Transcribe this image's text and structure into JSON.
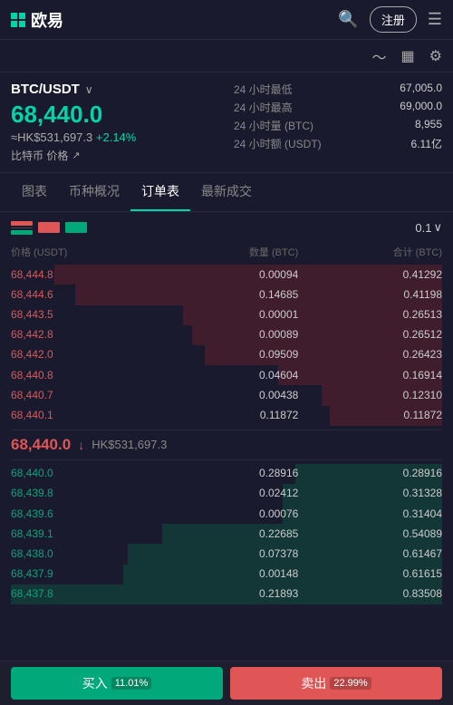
{
  "header": {
    "logo_text": "欧易",
    "register_label": "注册",
    "tab_icon": "≡"
  },
  "pair": {
    "name": "BTC/USDT",
    "main_price": "68,440.0",
    "hk_price": "≈HK$531,697.3",
    "change": "+2.14%",
    "sub_label": "比特币 价格",
    "stats": [
      {
        "label": "24 小时最低",
        "value": "67,005.0"
      },
      {
        "label": "24 小时最高",
        "value": "69,000.0"
      },
      {
        "label": "24 小时量 (BTC)",
        "value": "8,955"
      },
      {
        "label": "24 小时额 (USDT)",
        "value": "6.11亿"
      }
    ]
  },
  "tabs": [
    {
      "label": "图表",
      "active": false
    },
    {
      "label": "币种概况",
      "active": false
    },
    {
      "label": "订单表",
      "active": true
    },
    {
      "label": "最新成交",
      "active": false
    }
  ],
  "orderbook": {
    "precision": "0.1",
    "col_headers": [
      "价格 (USDT)",
      "数量 (BTC)",
      "合计 (BTC)"
    ],
    "asks": [
      {
        "price": "68,444.8",
        "qty": "0.00094",
        "total": "0.41292",
        "bar": 90
      },
      {
        "price": "68,444.6",
        "qty": "0.14685",
        "total": "0.41198",
        "bar": 85
      },
      {
        "price": "68,443.5",
        "qty": "0.00001",
        "total": "0.26513",
        "bar": 60
      },
      {
        "price": "68,442.8",
        "qty": "0.00089",
        "total": "0.26512",
        "bar": 58
      },
      {
        "price": "68,442.0",
        "qty": "0.09509",
        "total": "0.26423",
        "bar": 55
      },
      {
        "price": "68,440.8",
        "qty": "0.04604",
        "total": "0.16914",
        "bar": 38
      },
      {
        "price": "68,440.7",
        "qty": "0.00438",
        "total": "0.12310",
        "bar": 28
      },
      {
        "price": "68,440.1",
        "qty": "0.11872",
        "total": "0.11872",
        "bar": 26
      }
    ],
    "current_price": "68,440.0",
    "current_hk": "HK$531,697.3",
    "bids": [
      {
        "price": "68,440.0",
        "qty": "0.28916",
        "total": "0.28916",
        "bar": 34
      },
      {
        "price": "68,439.8",
        "qty": "0.02412",
        "total": "0.31328",
        "bar": 37
      },
      {
        "price": "68,439.6",
        "qty": "0.00076",
        "total": "0.31404",
        "bar": 37
      },
      {
        "price": "68,439.1",
        "qty": "0.22685",
        "total": "0.54089",
        "bar": 65
      },
      {
        "price": "68,438.0",
        "qty": "0.07378",
        "total": "0.61467",
        "bar": 73
      },
      {
        "price": "68,437.9",
        "qty": "0.00148",
        "total": "0.61615",
        "bar": 74
      },
      {
        "price": "68,437.8",
        "qty": "0.21893",
        "total": "0.83508",
        "bar": 100
      }
    ]
  },
  "bottom": {
    "buy_label": "买入",
    "buy_pct": "11.01%",
    "sell_label": "卖出",
    "sell_pct": "22.99%"
  }
}
